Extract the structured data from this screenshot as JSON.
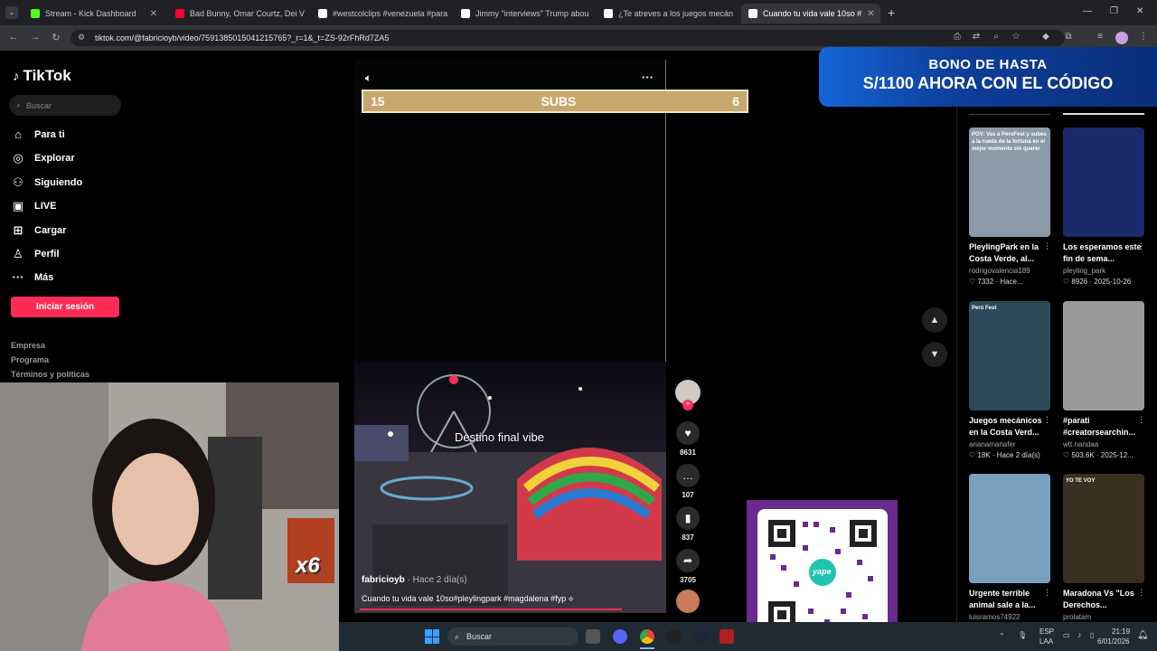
{
  "browser": {
    "tabs": [
      {
        "title": "Stream - Kick Dashboard",
        "favicon_color": "#53fc18",
        "active": false
      },
      {
        "title": "Bad Bunny, Omar Courtz, Dei V",
        "favicon_color": "#ff0033",
        "active": false
      },
      {
        "title": "#westcolclips #venezuela #para",
        "favicon_color": "#ffffff",
        "active": false
      },
      {
        "title": "Jimmy \"interviews\" Trump abou",
        "favicon_color": "#ffffff",
        "active": false
      },
      {
        "title": "¿Te atreves a los juegos mecán",
        "favicon_color": "#ffffff",
        "active": false
      },
      {
        "title": "Cuando tu vida vale 10so #",
        "favicon_color": "#ffffff",
        "active": true
      }
    ],
    "new_tab": "+",
    "url": "tiktok.com/@fabricioyb/video/7591385015041215765?_r=1&_t=ZS-92rFhRd7ZA5",
    "window_controls": [
      "—",
      "❐",
      "✕"
    ]
  },
  "sidebar": {
    "logo": "TikTok",
    "search_placeholder": "Buscar",
    "nav": [
      {
        "label": "Para ti",
        "icon": "home-icon",
        "glyph": "⌂"
      },
      {
        "label": "Explorar",
        "icon": "compass-icon",
        "glyph": "◎"
      },
      {
        "label": "Siguiendo",
        "icon": "following-icon",
        "glyph": "⚇"
      },
      {
        "label": "LIVE",
        "icon": "live-icon",
        "glyph": "▣"
      },
      {
        "label": "Cargar",
        "icon": "upload-icon",
        "glyph": "⊞"
      },
      {
        "label": "Perfil",
        "icon": "profile-icon",
        "glyph": "♙"
      },
      {
        "label": "Más",
        "icon": "more-icon",
        "glyph": "···"
      }
    ],
    "login_label": "Iniciar sesión",
    "footer": [
      "Empresa",
      "Programa",
      "Términos y políticas"
    ]
  },
  "video": {
    "more_glyph": "···",
    "subs_left": "15",
    "subs_label": "SUBS",
    "subs_right": "6",
    "overlay_text": "Destino final vibe",
    "author": "fabricioyb",
    "posted": "· Hace 2 día(s)",
    "description": "Cuando tu vida vale 10so#pleylingpark #magdalena #fyp ⟡",
    "likes": "8631",
    "comments": "107",
    "saves": "837",
    "shares": "3705"
  },
  "banner": {
    "line1": "BONO DE HASTA",
    "line2": "S/1100 AHORA CON EL CÓDIGO"
  },
  "recommendations": [
    {
      "title": "PleylingPark en la Costa Verde, al...",
      "user": "rodrigovalencia189",
      "likes": "7332",
      "date": "Hace...",
      "thumb_color": "#8a9aa8",
      "overlay": "POV: Vas a PeruFest y subes a la rueda de la fortuna en el mejor momento sin querer"
    },
    {
      "title": "Los esperamos este fin de sema...",
      "user": "pleyling_park",
      "likes": "8926",
      "date": "2025-10-26",
      "thumb_color": "#1a2a6a",
      "overlay": ""
    },
    {
      "title": "Juegos mecánicos en la Costa Verd...",
      "user": "arianamariafer",
      "likes": "18K",
      "date": "Hace 2 día(s)",
      "thumb_color": "#2c4a5a",
      "overlay": "Perú Fest"
    },
    {
      "title": "#parati #creatorsearchin...",
      "user": "wtt.nandaa",
      "likes": "503.6K",
      "date": "2025-12...",
      "thumb_color": "#9a9a9a",
      "overlay": ""
    },
    {
      "title": "Urgente terrible animal sale a la...",
      "user": "luisramos74922",
      "likes": "",
      "date": "",
      "thumb_color": "#7aa0c0",
      "overlay": ""
    },
    {
      "title": "Maradona Vs \"Los Derechos...",
      "user": "prolatam",
      "likes": "",
      "date": "",
      "thumb_color": "#3a3020",
      "overlay": "YO TE VOY"
    }
  ],
  "stream": {
    "multiplier": "x6",
    "qr_label": "yape"
  },
  "taskbar": {
    "search_placeholder": "Buscar",
    "lang1": "ESP",
    "lang2": "LAA",
    "time": "21:19",
    "date": "6/01/2026"
  }
}
